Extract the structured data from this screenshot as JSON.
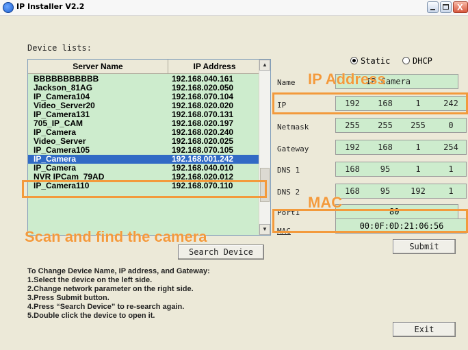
{
  "window": {
    "title": "IP Installer V2.2",
    "controls": {
      "minimize": "_",
      "maximize": "",
      "close": "X"
    }
  },
  "device_list": {
    "label": "Device lists:",
    "columns": [
      "Server Name",
      "IP Address"
    ],
    "rows": [
      {
        "name": "BBBBBBBBBBB",
        "ip": "192.168.040.161"
      },
      {
        "name": "Jackson_81AG",
        "ip": "192.168.020.050"
      },
      {
        "name": "IP_Camera104",
        "ip": "192.168.070.104"
      },
      {
        "name": "Video_Server20",
        "ip": "192.168.020.020"
      },
      {
        "name": "IP_Camera131",
        "ip": "192.168.070.131"
      },
      {
        "name": "705_IP_CAM",
        "ip": "192.168.020.197"
      },
      {
        "name": "IP_Camera",
        "ip": "192.168.020.240"
      },
      {
        "name": "Video_Server",
        "ip": "192.168.020.025"
      },
      {
        "name": "IP_Camera105",
        "ip": "192.168.070.105"
      },
      {
        "name": "IP_Camera",
        "ip": "192.168.001.242",
        "selected": true
      },
      {
        "name": "IP_Camera",
        "ip": "192.168.040.010"
      },
      {
        "name": "NVR IPCam_79AD",
        "ip": "192.168.020.012"
      },
      {
        "name": "IP_Camera110",
        "ip": "192.168.070.110"
      }
    ]
  },
  "mode": {
    "static_label": "Static",
    "dhcp_label": "DHCP",
    "selected": "Static"
  },
  "fields": {
    "name": {
      "label": "Name",
      "value": "IP Camera"
    },
    "ip": {
      "label": "IP",
      "octets": [
        "192",
        "168",
        "1",
        "242"
      ]
    },
    "netmask": {
      "label": "Netmask",
      "octets": [
        "255",
        "255",
        "255",
        "0"
      ]
    },
    "gateway": {
      "label": "Gateway",
      "octets": [
        "192",
        "168",
        "1",
        "254"
      ]
    },
    "dns1": {
      "label": "DNS 1",
      "octets": [
        "168",
        "95",
        "1",
        "1"
      ]
    },
    "dns2": {
      "label": "DNS 2",
      "octets": [
        "168",
        "95",
        "192",
        "1"
      ]
    },
    "port": {
      "label": "Port1",
      "value": "80"
    },
    "mac": {
      "label": "MAC",
      "value": "00:0F:0D:21:06:56"
    }
  },
  "buttons": {
    "search": "Search Device",
    "submit": "Submit",
    "exit": "Exit"
  },
  "instructions": [
    "To Change Device Name, IP address, and Gateway:",
    "1.Select the device on the left side.",
    "2.Change network parameter on the right side.",
    "3.Press Submit button.",
    "4.Press “Search Device” to re-search again.",
    "5.Double click the device to open it."
  ],
  "annotations": {
    "ip_address": "IP Address",
    "mac": "MAC",
    "scan": "Scan and find the camera",
    "color": "#f39a3c"
  }
}
